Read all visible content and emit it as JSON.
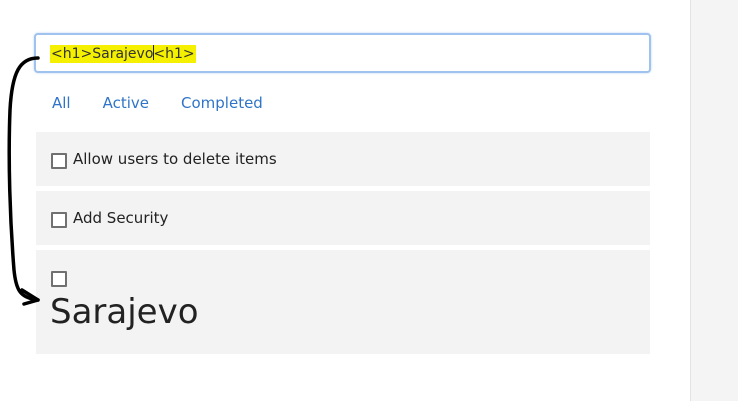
{
  "input": {
    "value": "<h1>Sarajevo<h1>",
    "before_caret": "<h1>Sarajevo",
    "after_caret": "<h1>"
  },
  "filters": [
    "All",
    "Active",
    "Completed"
  ],
  "items": [
    {
      "label": "Allow users to delete items",
      "checked": false
    },
    {
      "label": "Add Security",
      "checked": false
    },
    {
      "label": "Sarajevo",
      "checked": false
    }
  ],
  "colors": {
    "highlight": "#f4f000",
    "link": "#2f74c8",
    "item_bg": "#f3f3f3",
    "input_border": "#9fc3ee"
  },
  "annotation": {
    "icon": "curved-arrow-icon"
  }
}
